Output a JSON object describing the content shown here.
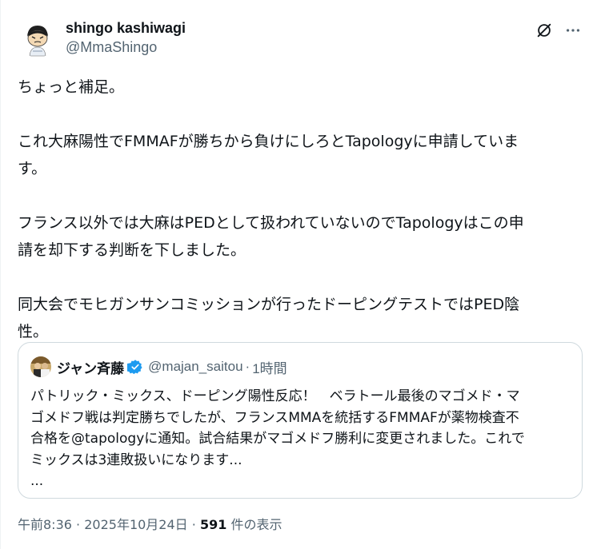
{
  "author": {
    "name": "shingo kashiwagi",
    "handle": "@MmaShingo"
  },
  "icons": {
    "grok": "grok-icon",
    "more": "more-icon",
    "verified": "verified-badge-icon"
  },
  "colors": {
    "text": "#0f1419",
    "secondary": "#536471",
    "border": "#cfd9de",
    "verified": "#1d9bf0"
  },
  "tweet": {
    "lines": [
      "ちょっと補足。",
      "これ大麻陽性でFMMAFが勝ちから負けにしろとTapologyに申請していま",
      "す。",
      "フランス以外では大麻はPEDとして扱われていないのでTapologyはこの申",
      "請を却下する判断を下しました。",
      "同大会でモヒガンサンコミッションが行ったドーピングテストではPED陰",
      "性。"
    ]
  },
  "quote": {
    "name": "ジャン斉藤",
    "handle": "@majan_saitou",
    "separator": "·",
    "time": "1時間",
    "lines": [
      "パトリック・ミックス、ドーピング陽性反応！　ベラトール最後のマゴメド・マ",
      "ゴメドフ戦は判定勝ちでしたが、フランスMMAを統括するFMMAFが薬物検査不",
      "合格を@tapologyに通知。試合結果がマゴメドフ勝利に変更されました。これで",
      "ミックスは3連敗扱いになります...",
      "..."
    ]
  },
  "meta": {
    "time": "午前8:36",
    "separator": "·",
    "date": "2025年10月24日",
    "views_count": "591",
    "views_label": "件の表示"
  }
}
